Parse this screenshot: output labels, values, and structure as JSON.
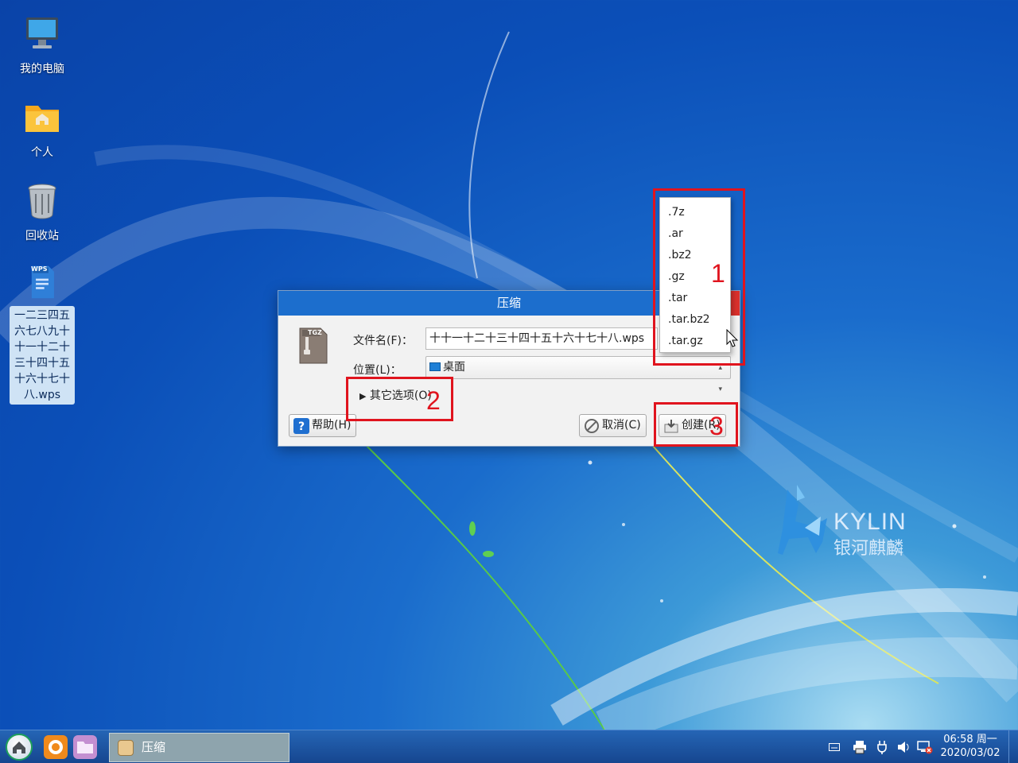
{
  "desktop": {
    "icons": [
      {
        "label": "我的电脑"
      },
      {
        "label": "个人"
      },
      {
        "label": "回收站"
      },
      {
        "label": "一二三四五六七八九十十一十二十三十四十五十六十七十八.wps",
        "badge": "WPS"
      }
    ],
    "brand": {
      "latin": "KYLIN",
      "cn": "银河麒麟"
    }
  },
  "dialog": {
    "title": "压缩",
    "archive_badge": "TGZ",
    "filename_label": "文件名(F)：",
    "filename_value": "十十一十二十三十四十五十六十七十八.wps",
    "location_label": "位置(L)：",
    "location_value": "桌面",
    "other_options": "其它选项(O)",
    "help_button": "帮助(H)",
    "cancel_button": "取消(C)",
    "create_button": "创建(R)"
  },
  "extension_menu": {
    "items": [
      ".7z",
      ".ar",
      ".bz2",
      ".gz",
      ".tar",
      ".tar.bz2",
      ".tar.gz"
    ]
  },
  "annotations": {
    "n1": "1",
    "n2": "2",
    "n3": "3",
    "color": "#e0141e"
  },
  "taskbar": {
    "active_task": "压缩",
    "time": "06:58 周一",
    "date": "2020/03/02"
  },
  "colors": {
    "titlebar": "#1c6ecd",
    "close": "#d9302c",
    "taskbar": "#16468f"
  }
}
